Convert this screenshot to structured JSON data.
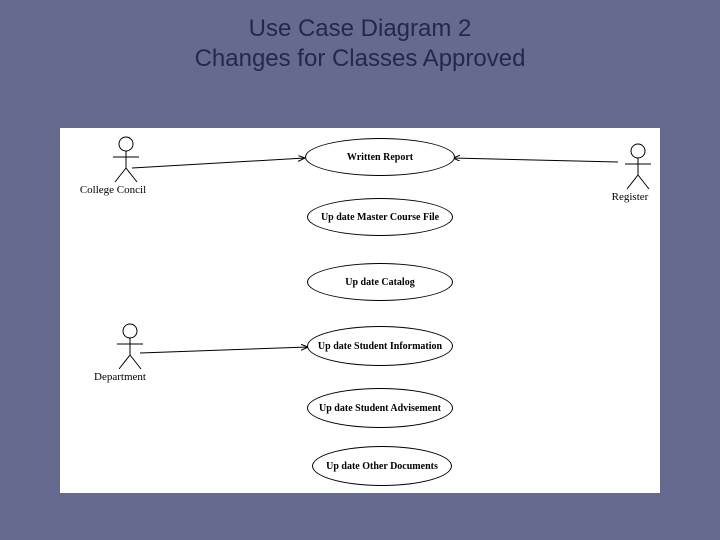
{
  "title": {
    "line1": "Use Case Diagram 2",
    "line2": "Changes for Classes Approved"
  },
  "actors": {
    "collegeCouncil": "College Concil",
    "register": "Register",
    "department": "Department"
  },
  "usecases": {
    "writtenReport": "Written Report",
    "updateMaster": "Up date Master Course File",
    "updateCatalog": "Up date Catalog",
    "updateStudentInfo": "Up date Student Information",
    "updateStudentAdvise": "Up date Student Advisement",
    "updateOtherDocs": "Up date Other Documents"
  }
}
